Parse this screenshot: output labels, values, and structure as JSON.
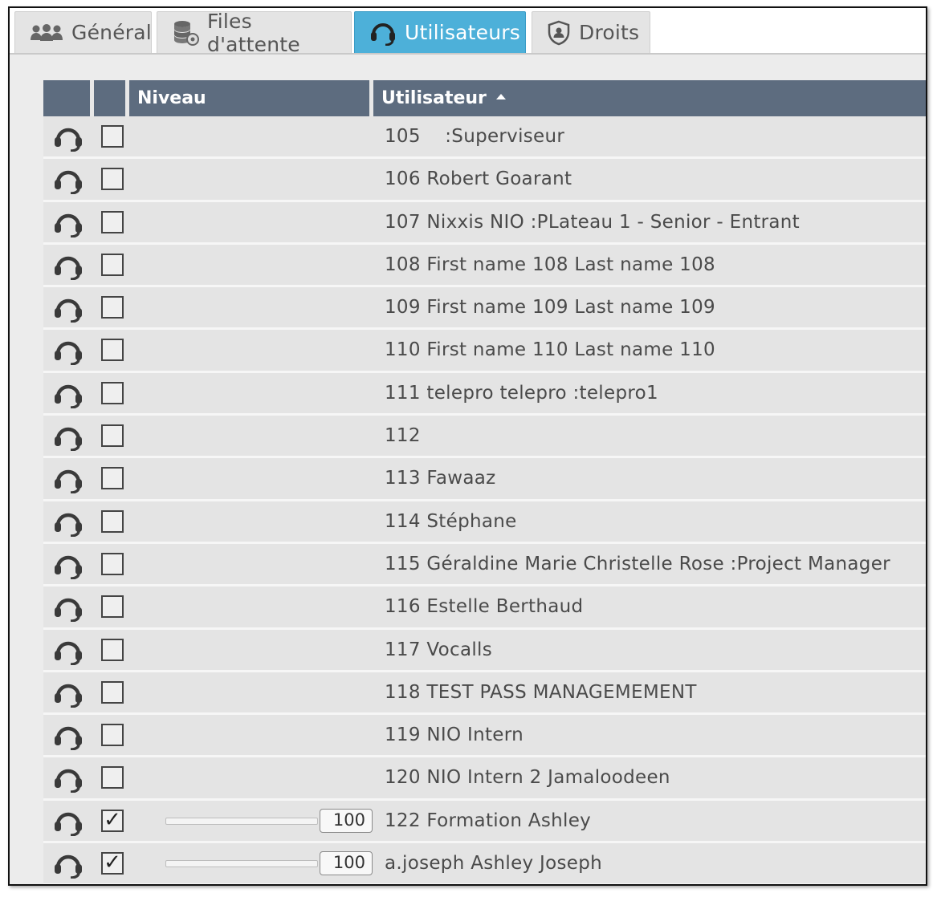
{
  "tabs": [
    {
      "label": "Général",
      "icon": "users-icon",
      "active": false
    },
    {
      "label": "Files d'attente",
      "icon": "database-icon",
      "active": false
    },
    {
      "label": "Utilisateurs",
      "icon": "headset-icon",
      "active": true
    },
    {
      "label": "Droits",
      "icon": "shield-icon",
      "active": false
    }
  ],
  "table": {
    "columns": [
      "",
      "",
      "Niveau",
      "Utilisateur"
    ],
    "sort_column": "Utilisateur",
    "sort_direction": "asc",
    "rows": [
      {
        "user": "105    :Superviseur",
        "checked": false,
        "level": null
      },
      {
        "user": "106 Robert Goarant",
        "checked": false,
        "level": null
      },
      {
        "user": "107 Nixxis NIO :PLateau 1 - Senior - Entrant",
        "checked": false,
        "level": null
      },
      {
        "user": "108 First name 108 Last name 108",
        "checked": false,
        "level": null
      },
      {
        "user": "109 First name 109 Last name 109",
        "checked": false,
        "level": null
      },
      {
        "user": "110 First name 110 Last name 110",
        "checked": false,
        "level": null
      },
      {
        "user": "111 telepro telepro :telepro1",
        "checked": false,
        "level": null
      },
      {
        "user": "112",
        "checked": false,
        "level": null
      },
      {
        "user": "113 Fawaaz",
        "checked": false,
        "level": null
      },
      {
        "user": "114 Stéphane",
        "checked": false,
        "level": null
      },
      {
        "user": "115 Géraldine Marie Christelle Rose :Project Manager",
        "checked": false,
        "level": null
      },
      {
        "user": "116 Estelle Berthaud",
        "checked": false,
        "level": null
      },
      {
        "user": "117 Vocalls",
        "checked": false,
        "level": null
      },
      {
        "user": "118 TEST PASS MANAGEMEMENT",
        "checked": false,
        "level": null
      },
      {
        "user": "119 NIO Intern",
        "checked": false,
        "level": null
      },
      {
        "user": "120 NIO Intern 2 Jamaloodeen",
        "checked": false,
        "level": null
      },
      {
        "user": "122 Formation Ashley",
        "checked": true,
        "level": "100"
      },
      {
        "user": "a.joseph Ashley Joseph",
        "checked": true,
        "level": "100"
      }
    ]
  },
  "colors": {
    "active_tab": "#4db0d9",
    "header_bg": "#5d6c7f",
    "row_bg": "#e4e4e4"
  }
}
